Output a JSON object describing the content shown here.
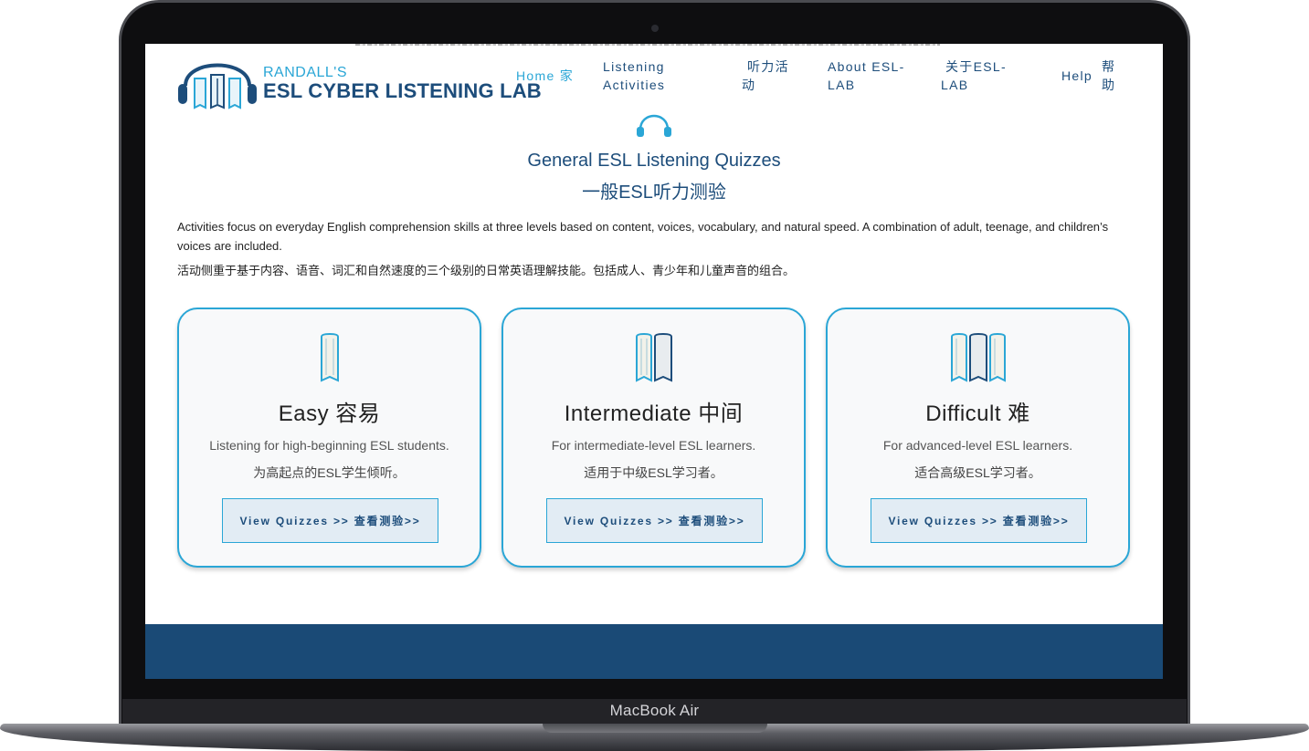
{
  "device": {
    "label": "MacBook Air"
  },
  "logo": {
    "small": "RANDALL'S",
    "big": "ESL CYBER LISTENING LAB"
  },
  "nav": {
    "home": "Home  家",
    "activities": [
      "Listening",
      "Activities"
    ],
    "activities_zh": [
      "听力活",
      "动"
    ],
    "about": [
      "About ESL-",
      "LAB"
    ],
    "about_zh": [
      "关于ESL-",
      "LAB"
    ],
    "help": "Help",
    "help_zh": [
      "帮",
      "助"
    ]
  },
  "heading": {
    "en": "General ESL Listening Quizzes",
    "zh": "一般ESL听力测验"
  },
  "description": {
    "en": "Activities focus on everyday English comprehension skills at three levels based on content, voices, vocabulary, and natural speed. A combination of adult, teenage, and children’s voices are included.",
    "zh": "活动侧重于基于内容、语音、词汇和自然速度的三个级别的日常英语理解技能。包括成人、青少年和儿童声音的组合。"
  },
  "cards": [
    {
      "title": "Easy  容易",
      "sub_en": "Listening for high-beginning ESL students.",
      "sub_zh": "为高起点的ESL学生倾听。",
      "button": "View Quizzes >> 查看测验>>",
      "icon": "single-book-icon"
    },
    {
      "title": "Intermediate  中间",
      "sub_en": "For intermediate-level ESL learners.",
      "sub_zh": "适用于中级ESL学习者。",
      "button": "View Quizzes >> 查看测验>>",
      "icon": "two-books-icon"
    },
    {
      "title": "Difficult  难",
      "sub_en": "For advanced-level ESL learners.",
      "sub_zh": "适合高级ESL学习者。",
      "button": "View Quizzes >> 查看测验>>",
      "icon": "three-books-icon"
    }
  ],
  "colors": {
    "brand_dark": "#1d4d7b",
    "brand_light": "#2aa6d6",
    "footer": "#1a4a76",
    "button_bg": "#e2ecf4"
  }
}
